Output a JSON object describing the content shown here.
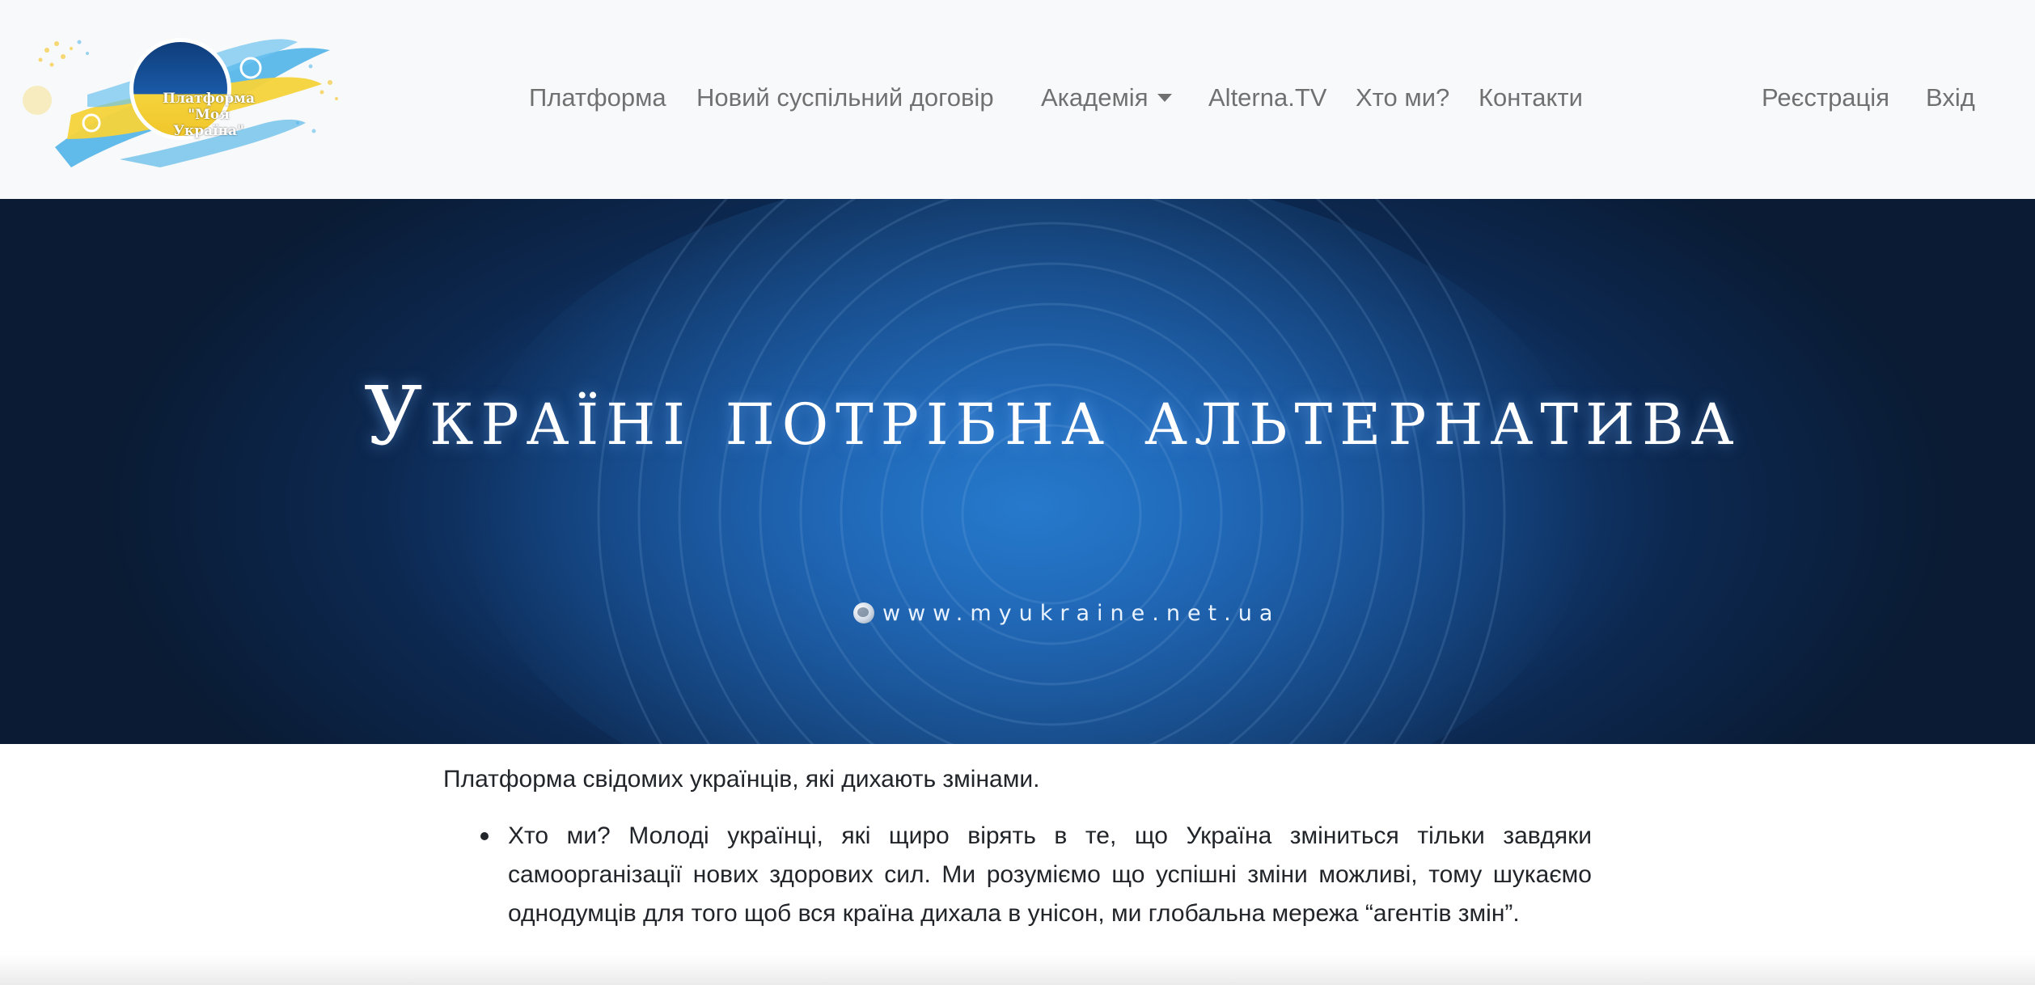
{
  "logo": {
    "line1": "Платформа",
    "line2": "\"Моя Україна\""
  },
  "nav": {
    "items": [
      {
        "label": "Платформа"
      },
      {
        "label": "Новий суспільний договір"
      },
      {
        "label": "Академія"
      },
      {
        "label": "Alterna.TV"
      },
      {
        "label": "Хто ми?"
      },
      {
        "label": "Контакти"
      }
    ],
    "register": "Реєстрація",
    "login": "Вхід"
  },
  "hero": {
    "title": "Україні потрібна альтернатива",
    "url": "www.myukraine.net.ua"
  },
  "content": {
    "intro": "Платформа свідомих українців, які дихають змінами.",
    "bullets": [
      "Хто ми? Молоді українці, які щиро вірять в те, що Україна зміниться тільки завдяки самоорганізації нових здорових сил. Ми розуміємо що успішні зміни можливі, тому шукаємо однодумців для того щоб вся країна дихала в унісон, ми глобальна мережа “агентів змін”."
    ]
  },
  "colors": {
    "navbar_bg": "#f8f9fa",
    "nav_text": "rgba(0,0,0,0.55)",
    "hero_center": "#1f6fc2",
    "hero_edge": "#0a1b33",
    "logo_blue": "#4fb3e8",
    "logo_yellow": "#f5d33a"
  }
}
